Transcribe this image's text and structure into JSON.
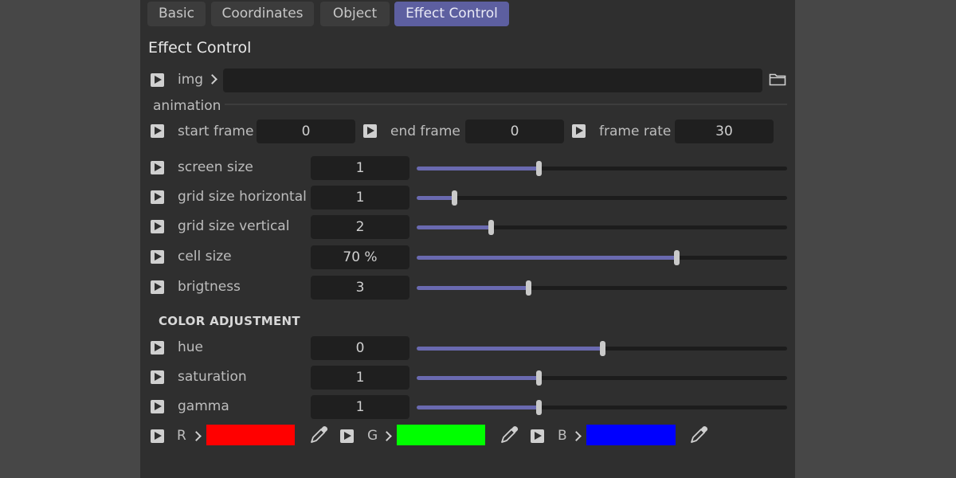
{
  "tabs": [
    {
      "label": "Basic",
      "active": false
    },
    {
      "label": "Coordinates",
      "active": false
    },
    {
      "label": "Object",
      "active": false
    },
    {
      "label": "Effect Control",
      "active": true
    }
  ],
  "section_title": "Effect Control",
  "img": {
    "label": "img",
    "value": ""
  },
  "animation": {
    "group_label": "animation",
    "start_frame": {
      "label": "start frame",
      "value": "0"
    },
    "end_frame": {
      "label": "end frame",
      "value": "0"
    },
    "frame_rate": {
      "label": "frame rate",
      "value": "30"
    }
  },
  "sliders": [
    {
      "label": "screen size",
      "value": "1",
      "fraction": 0.33
    },
    {
      "label": "grid size horizontal",
      "value": "1",
      "fraction": 0.1
    },
    {
      "label": "grid size vertical",
      "value": "2",
      "fraction": 0.2
    },
    {
      "label": "cell size",
      "value": "70 %",
      "fraction": 0.7
    },
    {
      "label": "brigtness",
      "value": "3",
      "fraction": 0.3
    }
  ],
  "color_adjustment": {
    "heading": "COLOR ADJUSTMENT",
    "sliders": [
      {
        "label": "hue",
        "value": "0",
        "fraction": 0.5
      },
      {
        "label": "saturation",
        "value": "1",
        "fraction": 0.33
      },
      {
        "label": "gamma",
        "value": "1",
        "fraction": 0.33
      }
    ]
  },
  "colors": [
    {
      "label": "R",
      "swatch": "#ff0000"
    },
    {
      "label": "G",
      "swatch": "#00ff00"
    },
    {
      "label": "B",
      "swatch": "#0000ff"
    }
  ],
  "theme": {
    "accent": "#5d5fa0",
    "slider_fill": "#6a6ab0"
  }
}
